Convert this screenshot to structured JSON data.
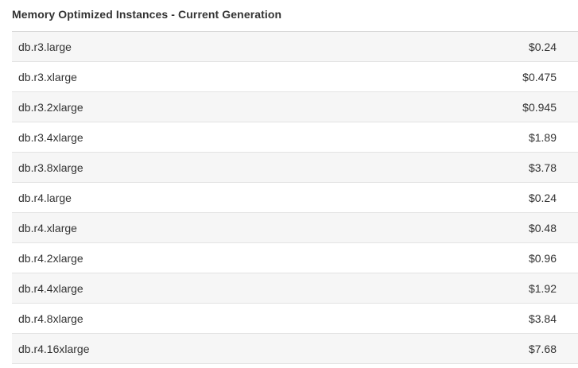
{
  "section": {
    "title": "Memory Optimized Instances - Current Generation"
  },
  "rows": [
    {
      "instance": "db.r3.large",
      "price": "$0.24"
    },
    {
      "instance": "db.r3.xlarge",
      "price": "$0.475"
    },
    {
      "instance": "db.r3.2xlarge",
      "price": "$0.945"
    },
    {
      "instance": "db.r3.4xlarge",
      "price": "$1.89"
    },
    {
      "instance": "db.r3.8xlarge",
      "price": "$3.78"
    },
    {
      "instance": "db.r4.large",
      "price": "$0.24"
    },
    {
      "instance": "db.r4.xlarge",
      "price": "$0.48"
    },
    {
      "instance": "db.r4.2xlarge",
      "price": "$0.96"
    },
    {
      "instance": "db.r4.4xlarge",
      "price": "$1.92"
    },
    {
      "instance": "db.r4.8xlarge",
      "price": "$3.84"
    },
    {
      "instance": "db.r4.16xlarge",
      "price": "$7.68"
    }
  ]
}
